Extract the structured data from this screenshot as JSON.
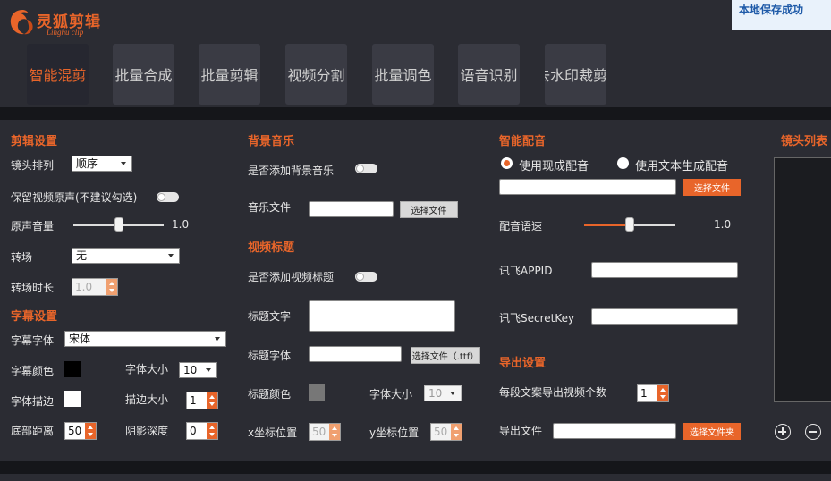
{
  "app": {
    "logo_title": "灵狐剪辑",
    "logo_subtitle": "Linghu clip",
    "toast": "本地保存成功",
    "accent_color": "#e8652a"
  },
  "nav": {
    "tabs": [
      "智能混剪",
      "批量合成",
      "批量剪辑",
      "视频分割",
      "批量调色",
      "语音识别",
      "去水印裁剪"
    ],
    "active_index": 0
  },
  "edit": {
    "title": "剪辑设置",
    "order_label": "镜头排列",
    "order_value": "顺序",
    "keep_audio_label": "保留视频原声(不建议勾选)",
    "volume_label": "原声音量",
    "volume_value": "1.0",
    "volume_level": 0.5,
    "transition_label": "转场",
    "transition_value": "无",
    "transition_dur_label": "转场时长",
    "transition_dur_value": "1.0"
  },
  "subtitle": {
    "title": "字幕设置",
    "font_label": "字幕字体",
    "font_value": "宋体",
    "color_label": "字幕颜色",
    "color": "#000000",
    "size_label": "字体大小",
    "size_value": "10",
    "stroke_label": "字体描边",
    "stroke_color": "#ffffff",
    "stroke_size_label": "描边大小",
    "stroke_size_value": "1",
    "bottom_label": "底部距离",
    "bottom_value": "50",
    "shadow_label": "阴影深度",
    "shadow_value": "0"
  },
  "music": {
    "title": "背景音乐",
    "add_label": "是否添加背景音乐",
    "file_label": "音乐文件",
    "file_value": "",
    "choose_btn": "选择文件"
  },
  "video_title": {
    "title": "视频标题",
    "add_label": "是否添加视频标题",
    "text_label": "标题文字",
    "text_value": "",
    "font_label": "标题字体",
    "font_value": "",
    "font_btn": "选择文件（.ttf）",
    "color_label": "标题颜色",
    "color": "#777777",
    "size_label": "字体大小",
    "size_value": "10",
    "x_label": "x坐标位置",
    "x_value": "50",
    "y_label": "y坐标位置",
    "y_value": "50"
  },
  "voice": {
    "title": "智能配音",
    "opt_existing": "使用现成配音",
    "opt_tts": "使用文本生成配音",
    "selected": "existing",
    "file_value": "",
    "choose_btn": "选择文件",
    "speed_label": "配音语速",
    "speed_value": "1.0",
    "speed_level": 0.5,
    "appid_label": "讯飞APPID",
    "appid_value": "",
    "secret_label": "讯飞SecretKey",
    "secret_value": ""
  },
  "export": {
    "title": "导出设置",
    "count_label": "每段文案导出视频个数",
    "count_value": "1",
    "file_label": "导出文件",
    "file_value": "",
    "choose_btn": "选择文件夹"
  },
  "clips": {
    "title": "镜头列表"
  }
}
